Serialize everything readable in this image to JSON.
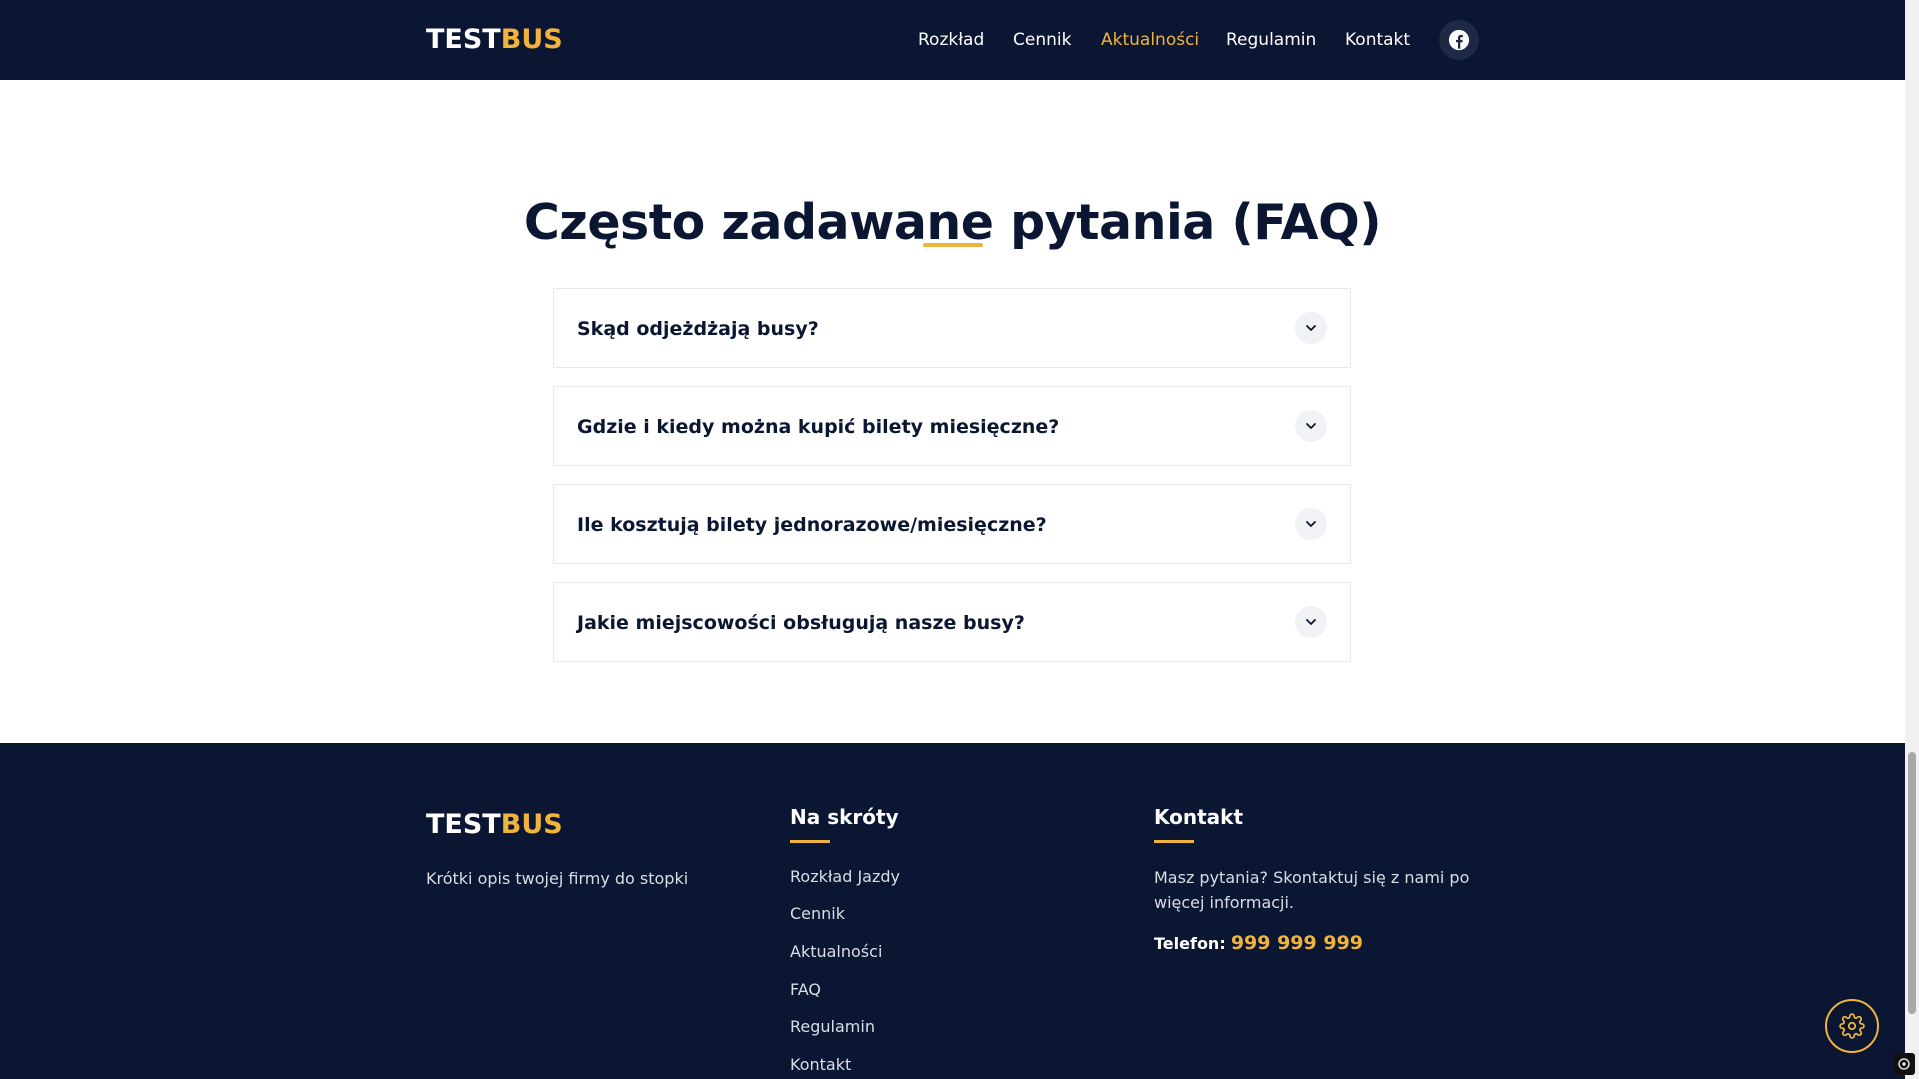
{
  "header": {
    "logo_main": "TEST",
    "logo_accent": "BUS",
    "nav": [
      {
        "label": "Rozkład"
      },
      {
        "label": "Cennik"
      },
      {
        "label": "Aktualności"
      },
      {
        "label": "Regulamin"
      },
      {
        "label": "Kontakt"
      }
    ],
    "active_nav": "Aktualności",
    "social_icon": "facebook-icon"
  },
  "faq": {
    "title": "Często zadawane pytania (FAQ)",
    "items": [
      {
        "question": "Skąd odjeżdżają busy?"
      },
      {
        "question": "Gdzie i kiedy można kupić bilety miesięczne?"
      },
      {
        "question": "Ile kosztują bilety jednorazowe/miesięczne?"
      },
      {
        "question": "Jakie miejscowości obsługują nasze busy?"
      }
    ],
    "expand_icon": "chevron-down-icon"
  },
  "footer": {
    "logo_main": "TEST",
    "logo_accent": "BUS",
    "description": "Krótki opis twojej firmy do stopki",
    "shortcuts": {
      "heading": "Na skróty",
      "links": [
        {
          "label": "Rozkład Jazdy"
        },
        {
          "label": "Cennik"
        },
        {
          "label": "Aktualności"
        },
        {
          "label": "FAQ"
        },
        {
          "label": "Regulamin"
        },
        {
          "label": "Kontakt"
        }
      ]
    },
    "contact": {
      "heading": "Kontakt",
      "text": "Masz pytania? Skontaktuj się z nami po więcej informacji.",
      "phone_label": "Telefon:",
      "phone_number": "999 999 999"
    }
  },
  "floating": {
    "settings_icon": "gear-icon"
  },
  "colors": {
    "navy": "#0b1633",
    "accent": "#f0b43c",
    "white": "#ffffff"
  }
}
